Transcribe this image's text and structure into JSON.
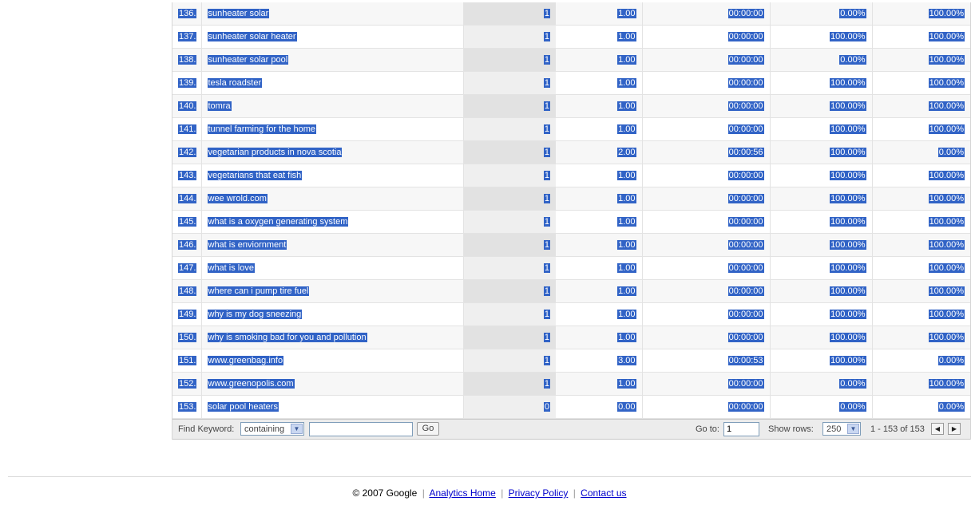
{
  "table": {
    "rows": [
      [
        "136.",
        "sunheater solar",
        "1",
        "1.00",
        "00:00:00",
        "0.00%",
        "100.00%"
      ],
      [
        "137.",
        "sunheater solar heater",
        "1",
        "1.00",
        "00:00:00",
        "100.00%",
        "100.00%"
      ],
      [
        "138.",
        "sunheater solar pool",
        "1",
        "1.00",
        "00:00:00",
        "0.00%",
        "100.00%"
      ],
      [
        "139.",
        "tesla roadster",
        "1",
        "1.00",
        "00:00:00",
        "100.00%",
        "100.00%"
      ],
      [
        "140.",
        "tomra",
        "1",
        "1.00",
        "00:00:00",
        "100.00%",
        "100.00%"
      ],
      [
        "141.",
        "tunnel farming for the home",
        "1",
        "1.00",
        "00:00:00",
        "100.00%",
        "100.00%"
      ],
      [
        "142.",
        "vegetarian products in nova scotia",
        "1",
        "2.00",
        "00:00:56",
        "100.00%",
        "0.00%"
      ],
      [
        "143.",
        "vegetarians that eat fish",
        "1",
        "1.00",
        "00:00:00",
        "100.00%",
        "100.00%"
      ],
      [
        "144.",
        "wee wrold.com",
        "1",
        "1.00",
        "00:00:00",
        "100.00%",
        "100.00%"
      ],
      [
        "145.",
        "what is a oxygen generating system",
        "1",
        "1.00",
        "00:00:00",
        "100.00%",
        "100.00%"
      ],
      [
        "146.",
        "what is enviornment",
        "1",
        "1.00",
        "00:00:00",
        "100.00%",
        "100.00%"
      ],
      [
        "147.",
        "what is love",
        "1",
        "1.00",
        "00:00:00",
        "100.00%",
        "100.00%"
      ],
      [
        "148.",
        "where can i pump tire fuel",
        "1",
        "1.00",
        "00:00:00",
        "100.00%",
        "100.00%"
      ],
      [
        "149.",
        "why is my dog sneezing",
        "1",
        "1.00",
        "00:00:00",
        "100.00%",
        "100.00%"
      ],
      [
        "150.",
        "why is smoking bad for you and pollution",
        "1",
        "1.00",
        "00:00:00",
        "100.00%",
        "100.00%"
      ],
      [
        "151.",
        "www.greenbag.info",
        "1",
        "3.00",
        "00:00:53",
        "100.00%",
        "0.00%"
      ],
      [
        "152.",
        "www.greenopolis.com",
        "1",
        "1.00",
        "00:00:00",
        "0.00%",
        "100.00%"
      ],
      [
        "153.",
        "solar pool heaters",
        "0",
        "0.00",
        "00:00:00",
        "0.00%",
        "0.00%"
      ]
    ]
  },
  "controls": {
    "find_keyword_label": "Find Keyword:",
    "match_select_value": "containing",
    "go_button": "Go",
    "goto_label": "Go to:",
    "goto_value": "1",
    "show_rows_label": "Show rows:",
    "show_rows_value": "250",
    "range_text": "1 - 153 of 153",
    "prev_icon": "triangle-left",
    "next_icon": "triangle-right"
  },
  "footer": {
    "copyright": "© 2007 Google",
    "links": [
      "Analytics Home",
      "Privacy Policy",
      "Contact us"
    ]
  },
  "colors": {
    "selection": "#3163c6",
    "link": "#0000cc"
  }
}
